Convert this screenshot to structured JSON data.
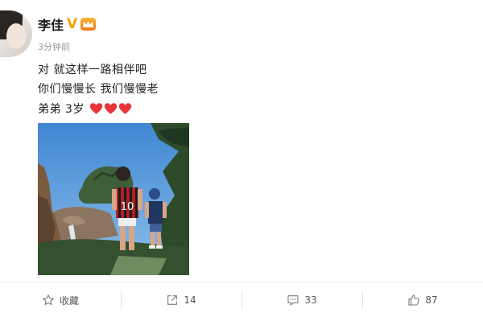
{
  "post": {
    "username": "李佳",
    "verified_mark": "V",
    "time": "3分钟前",
    "lines": [
      "对 就这样一路相伴吧",
      "你们慢慢长 我们慢慢老"
    ],
    "last_line": "弟弟 3岁",
    "hearts": 3,
    "heart_color": "#e8333a",
    "photo": {
      "jersey_text": "10",
      "colors": {
        "sky": "#4f94d8",
        "jersey_red": "#b01f25",
        "jersey_black": "#1a1a1a"
      }
    }
  },
  "actions": [
    {
      "icon": "star-icon",
      "label": "收藏"
    },
    {
      "icon": "share-icon",
      "label": "14"
    },
    {
      "icon": "comment-icon",
      "label": "33"
    },
    {
      "icon": "like-icon",
      "label": "87"
    }
  ],
  "colors": {
    "verified": "#f0a20a",
    "time": "#999999",
    "text": "#222222"
  }
}
